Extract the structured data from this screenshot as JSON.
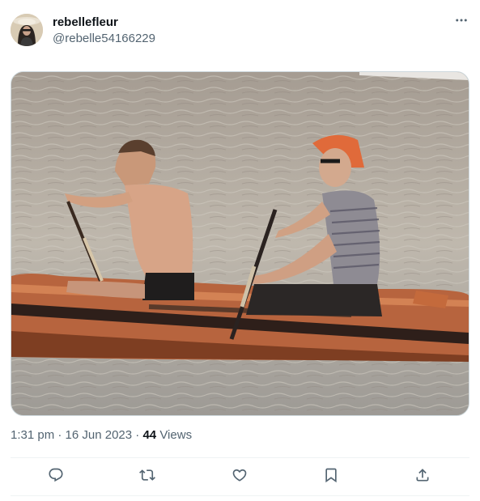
{
  "tweet": {
    "display_name": "rebellefleur",
    "handle": "@rebelle54166229",
    "time": "1:31 pm",
    "separator": "·",
    "date": "16 Jun 2023",
    "views_count": "44",
    "views_label": "Views"
  },
  "icons": {
    "more": "more-horizontal-icon",
    "reply": "reply-icon",
    "retweet": "retweet-icon",
    "like": "heart-icon",
    "bookmark": "bookmark-icon",
    "share": "share-icon"
  },
  "colors": {
    "text": "#0f1419",
    "secondary": "#536471",
    "border": "#cfd9de",
    "divider": "#eff3f4"
  }
}
